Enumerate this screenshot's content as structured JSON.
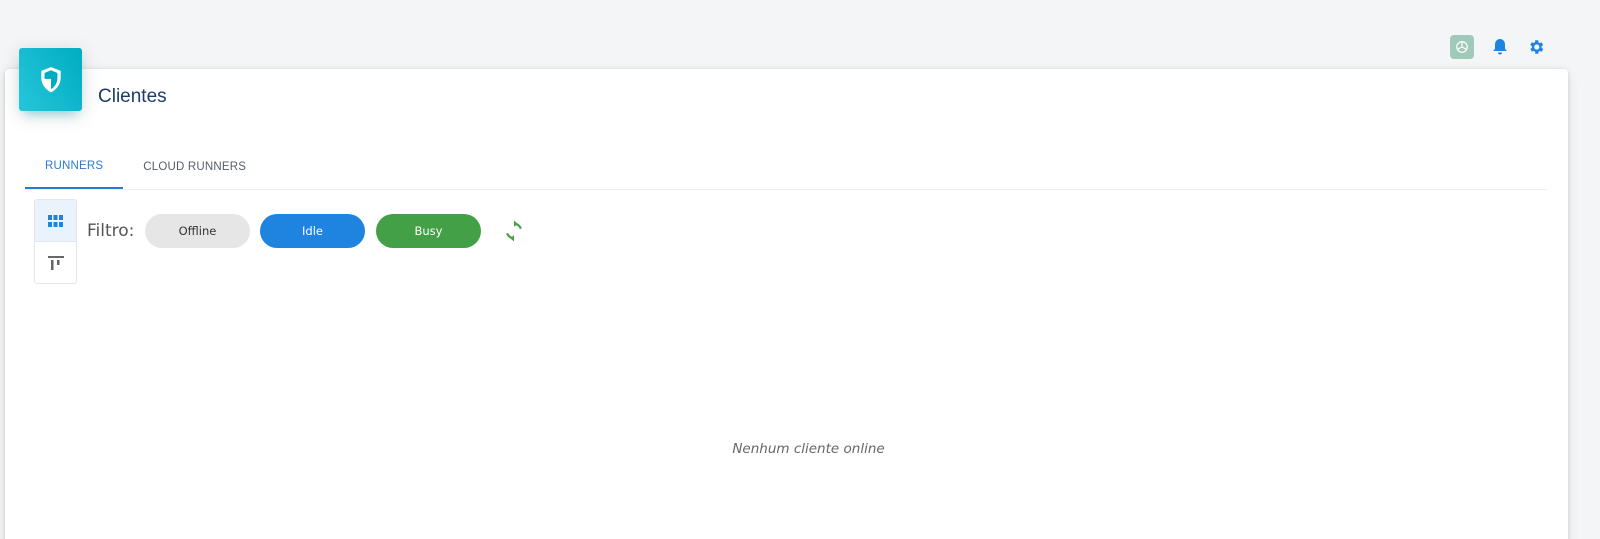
{
  "header": {
    "icons": [
      "openai-icon",
      "bell-icon",
      "gear-icon"
    ]
  },
  "card": {
    "title": "Clientes",
    "icon": "shield-icon"
  },
  "tabs": [
    {
      "label": "RUNNERS",
      "active": true
    },
    {
      "label": "CLOUD RUNNERS",
      "active": false
    }
  ],
  "toolbar": {
    "view_modes": [
      "grid-view-icon",
      "top-align-icon"
    ],
    "active_view": "grid",
    "filter_label": "Filtro:",
    "filters": [
      {
        "label": "Offline",
        "color": "#e6e6e6"
      },
      {
        "label": "Idle",
        "color": "#1e84e0"
      },
      {
        "label": "Busy",
        "color": "#43a047"
      }
    ],
    "refresh_icon": "refresh-icon"
  },
  "main": {
    "empty_message": "Nenhum cliente online"
  },
  "colors": {
    "accent": "#2a7bd4",
    "title": "#1d3c68",
    "card_icon": "#00acc1",
    "refresh": "#43a047"
  }
}
